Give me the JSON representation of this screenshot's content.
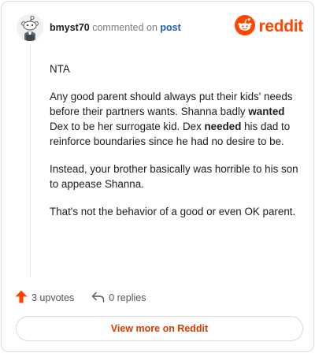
{
  "header": {
    "username": "bmyst70",
    "action": "commented on",
    "post_link": "post",
    "brand": "reddit"
  },
  "comment": {
    "p1": "NTA",
    "p2_a": "Any good parent should always put their kids' needs before their partners wants. Shanna badly ",
    "p2_b": "wanted",
    "p2_c": " Dex to be her surrogate kid. Dex ",
    "p2_d": "needed",
    "p2_e": " his dad to reinforce boundaries since he had no desire to be.",
    "p3": "Instead, your brother basically was horrible to his son to appease Shanna.",
    "p4": "That's not the behavior of a good or even OK parent."
  },
  "actions": {
    "upvotes": "3 upvotes",
    "replies": "0 replies"
  },
  "footer": {
    "view_more": "View more on Reddit"
  },
  "colors": {
    "brand": "#ff4500",
    "link": "#1c5cb3",
    "button_text": "#d93a00"
  },
  "icons": [
    "avatar-snoo",
    "reddit-logo-icon",
    "upvote-arrow-icon",
    "reply-arrow-icon"
  ]
}
